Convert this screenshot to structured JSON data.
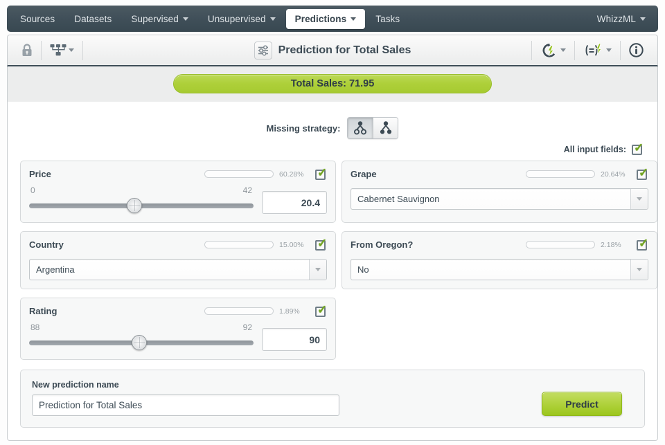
{
  "nav": {
    "items": [
      {
        "label": "Sources",
        "dropdown": false,
        "active": false
      },
      {
        "label": "Datasets",
        "dropdown": false,
        "active": false
      },
      {
        "label": "Supervised",
        "dropdown": true,
        "active": false
      },
      {
        "label": "Unsupervised",
        "dropdown": true,
        "active": false
      },
      {
        "label": "Predictions",
        "dropdown": true,
        "active": true
      },
      {
        "label": "Tasks",
        "dropdown": false,
        "active": false
      }
    ],
    "account": "WhizzML"
  },
  "toolbar": {
    "lock_icon": "lock-icon",
    "model_icon": "model-tree-icon",
    "title": "Prediction for Total Sales",
    "title_icon": "prediction-sliders-icon",
    "right_icons": [
      "batch-prediction-icon",
      "evaluation-icon",
      "info-icon"
    ]
  },
  "result": {
    "banner": "Total Sales: 71.95"
  },
  "strategy": {
    "label": "Missing strategy:",
    "options": [
      {
        "name": "last-prediction-strategy",
        "selected": true
      },
      {
        "name": "proportional-strategy",
        "selected": false
      }
    ]
  },
  "all_fields": {
    "label": "All input fields:",
    "checked": true
  },
  "fields": [
    {
      "name": "Price",
      "type": "slider",
      "importance_pct": "60.28%",
      "importance_value": 60.28,
      "checked": true,
      "min": "0",
      "max": "42",
      "value": "20.4",
      "knob_pct": 42
    },
    {
      "name": "Grape",
      "type": "select",
      "importance_pct": "20.64%",
      "importance_value": 20.64,
      "checked": true,
      "value": "Cabernet Sauvignon"
    },
    {
      "name": "Country",
      "type": "select",
      "importance_pct": "15.00%",
      "importance_value": 15.0,
      "checked": true,
      "value": "Argentina"
    },
    {
      "name": "From Oregon?",
      "type": "select",
      "importance_pct": "2.18%",
      "importance_value": 2.18,
      "checked": true,
      "value": "No"
    },
    {
      "name": "Rating",
      "type": "slider",
      "importance_pct": "1.89%",
      "importance_value": 1.89,
      "checked": true,
      "min": "88",
      "max": "92",
      "value": "90",
      "knob_pct": 44
    }
  ],
  "footer": {
    "label": "New prediction name",
    "name_value": "Prediction for Total Sales",
    "predict_label": "Predict"
  },
  "colors": {
    "accent_green": "#aed03a",
    "nav_dark": "#41505a",
    "text_dark": "#3c4a54",
    "check_green": "#72a422"
  }
}
